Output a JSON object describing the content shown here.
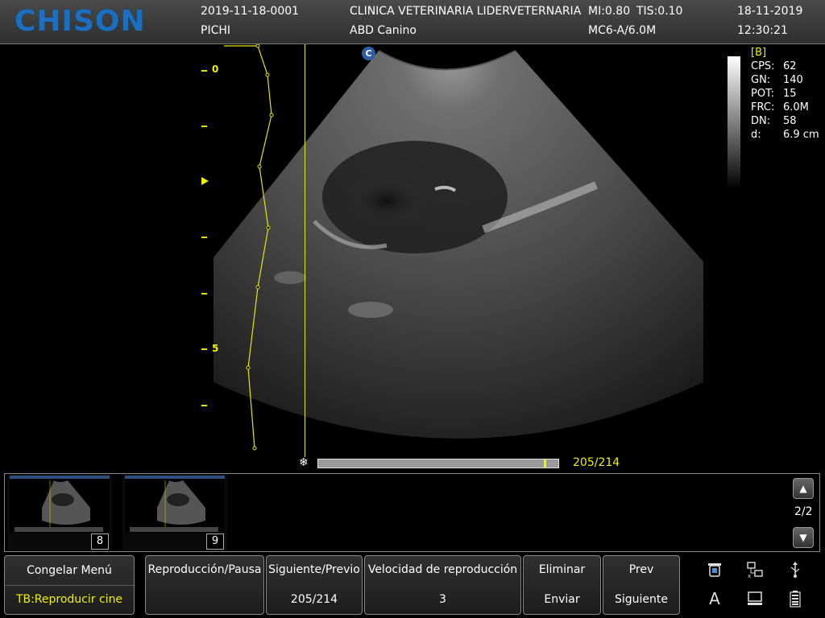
{
  "header": {
    "logo": "CHISON",
    "patient_id": "2019-11-18-0001",
    "patient_name": "PICHI",
    "clinic": "CLINICA VETERINARIA LIDERVETERNARIA",
    "exam": "ABD Canino",
    "mi": "MI:0.80",
    "tis": "TIS:0.10",
    "probe": "MC6-A/6.0M",
    "date": "18-11-2019",
    "time": "12:30:21"
  },
  "image": {
    "badge": "C",
    "depth_labels": {
      "d0": "0",
      "d5": "5"
    },
    "params": {
      "mode": "[B]",
      "rows": [
        {
          "k": "CPS:",
          "v": "62"
        },
        {
          "k": "GN:",
          "v": "140"
        },
        {
          "k": "POT:",
          "v": "15"
        },
        {
          "k": "FRC:",
          "v": "6.0M"
        },
        {
          "k": "DN:",
          "v": "58"
        },
        {
          "k": "d:",
          "v": "6.9 cm"
        }
      ]
    }
  },
  "cine": {
    "counter": "205/214",
    "current": 205,
    "total": 214,
    "icon": "snowflake-icon"
  },
  "thumbnails": {
    "items": [
      {
        "number": "8"
      },
      {
        "number": "9"
      }
    ],
    "page": "2/2",
    "up_icon": "arrow-up-icon",
    "down_icon": "arrow-down-icon"
  },
  "menu": {
    "freeze_top": "Congelar Menú",
    "freeze_bottom": "TB:Reproducir cine",
    "b1_top": "Reproducción/Pausa",
    "b1_bottom": "",
    "b2_top": "Siguiente/Previo",
    "b2_bottom": "205/214",
    "b3_top": "Velocidad de reproducción",
    "b3_bottom": "3",
    "b4_top": "Eliminar",
    "b4_bottom": "Enviar",
    "b5_top": "Prev",
    "b5_bottom": "Siguiente"
  },
  "status_icons": [
    "trash-icon",
    "network-icon",
    "usb-icon",
    "font-icon",
    "monitor-icon",
    "battery-icon"
  ],
  "colors": {
    "accent": "#f0f000",
    "logo": "#1a6fc0"
  }
}
